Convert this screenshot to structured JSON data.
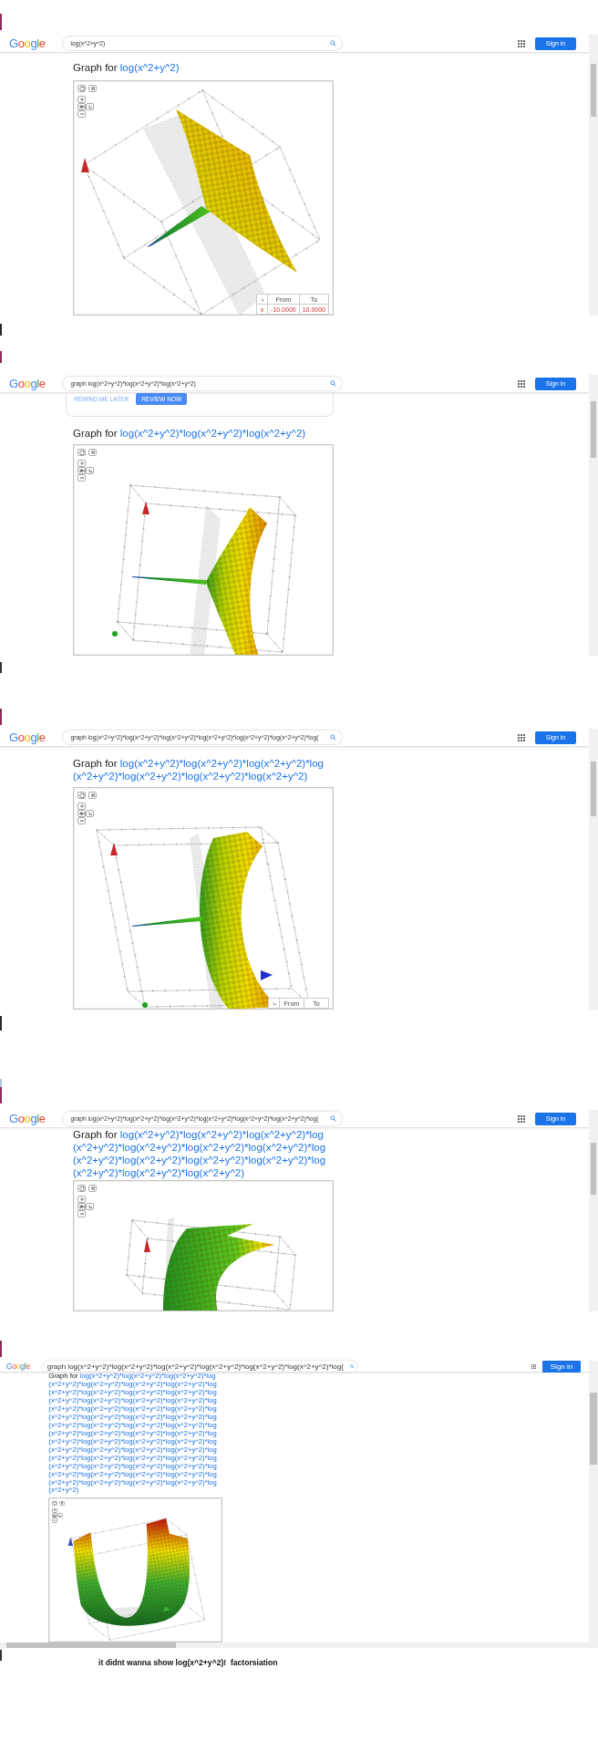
{
  "panels": [
    {
      "logo": "Google",
      "search": {
        "value": "log(x^2+y^2)"
      },
      "sign_in": "Sign in",
      "graph": {
        "heading": "Graph for",
        "expression": "log(x^2+y^2)",
        "kind": "fold",
        "range_table": {
          "columns": [
            "From",
            "To"
          ],
          "rows": [
            {
              "axis": "x",
              "from": "-10.0000",
              "to": "10.0000"
            }
          ]
        }
      }
    },
    {
      "logo": "Google",
      "search": {
        "value": "graph log(x^2+y^2)*log(x^2+y^2)*log(x^2+y^2)"
      },
      "sign_in": "Sign in",
      "prompt": {
        "link": "REMIND ME LATER",
        "button": "REVIEW NOW"
      },
      "graph": {
        "heading": "Graph for",
        "expression": "log(x^2+y^2)*log(x^2+y^2)*log(x^2+y^2)",
        "kind": "arc"
      }
    },
    {
      "logo": "Google",
      "search": {
        "value": "graph log(x^2+y^2)*log(x^2+y^2)*log(x^2+y^2)*log(x^2+y^2)*log(x^2+y^2)*log(x^2+y^2)*log("
      },
      "sign_in": "Sign in",
      "graph": {
        "heading": "Graph for",
        "expression": "log(x^2+y^2)*log(x^2+y^2)*log(x^2+y^2)*log(x^2+y^2)*log(x^2+y^2)*log(x^2+y^2)*log(x^2+y^2)",
        "kind": "crescent",
        "range_table": {
          "columns": [
            "From",
            "To"
          ]
        }
      }
    },
    {
      "logo": "Google",
      "search": {
        "value": "graph log(x^2+y^2)*log(x^2+y^2)*log(x^2+y^2)*log(x^2+y^2)*log(x^2+y^2)*log(x^2+y^2)*log("
      },
      "sign_in": "Sign in",
      "graph": {
        "heading": "Graph for",
        "expression": "log(x^2+y^2)*log(x^2+y^2)*log(x^2+y^2)*log(x^2+y^2)*log(x^2+y^2)*log(x^2+y^2)*log(x^2+y^2)*log(x^2+y^2)*log(x^2+y^2)*log(x^2+y^2)*log(x^2+y^2)*log(x^2+y^2)*log(x^2+y^2)*log(x^2+y^2)",
        "kind": "sheet"
      }
    },
    {
      "logo": "Google",
      "search": {
        "value": "graph log(x^2+y^2)*log(x^2+y^2)*log(x^2+y^2)*log(x^2+y^2)*log(x^2+y^2)*log(x^2+y^2)*log("
      },
      "sign_in": "Sign in",
      "graph": {
        "heading": "Graph for",
        "expression": "log(x^2+y^2)*log(x^2+y^2)*log(x^2+y^2)*log(x^2+y^2)*log(x^2+y^2)*log(x^2+y^2)*log(x^2+y^2)*log(x^2+y^2)*log(x^2+y^2)*log(x^2+y^2)*log(x^2+y^2)*log(x^2+y^2)*log(x^2+y^2)*log(x^2+y^2)*log(x^2+y^2)*log(x^2+y^2)*log(x^2+y^2)*log(x^2+y^2)*log(x^2+y^2)*log(x^2+y^2)*log(x^2+y^2)*log(x^2+y^2)*log(x^2+y^2)*log(x^2+y^2)*log(x^2+y^2)*log(x^2+y^2)*log(x^2+y^2)*log(x^2+y^2)*log(x^2+y^2)*log(x^2+y^2)*log(x^2+y^2)*log(x^2+y^2)*log(x^2+y^2)*log(x^2+y^2)*log(x^2+y^2)*log(x^2+y^2)*log(x^2+y^2)*log(x^2+y^2)*log(x^2+y^2)*log(x^2+y^2)*log(x^2+y^2)*log(x^2+y^2)*log(x^2+y^2)*log(x^2+y^2)*log(x^2+y^2)*log(x^2+y^2)*log(x^2+y^2)*log(x^2+y^2)*log(x^2+y^2)*log(x^2+y^2)*log(x^2+y^2)*log(x^2+y^2)*log(x^2+y^2)*log(x^2+y^2)*log(x^2+y^2)*log(x^2+y^2)",
        "kind": "trough"
      }
    }
  ],
  "caption": "it didnt wanna show log(x^2+y^2)!  factorsiation"
}
